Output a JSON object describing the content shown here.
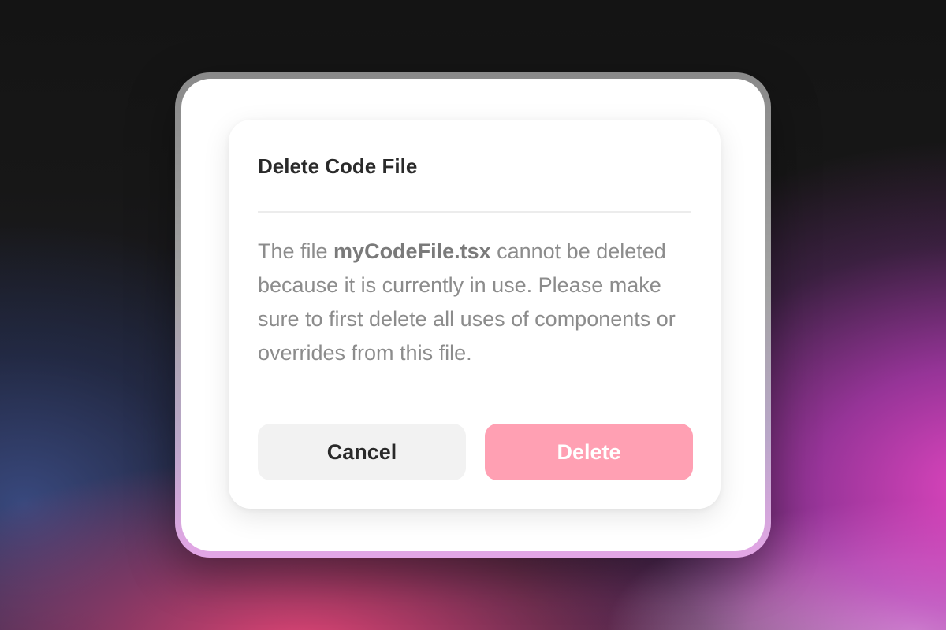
{
  "dialog": {
    "title": "Delete Code File",
    "message_prefix": "The file ",
    "file_name": "myCodeFile.tsx",
    "message_suffix": " cannot be deleted because it is currently in use. Please make sure to first delete all uses of components or overrides from this file.",
    "cancel_label": "Cancel",
    "delete_label": "Delete"
  },
  "colors": {
    "delete_button": "#ffa0b3",
    "cancel_button": "#f2f2f2",
    "title_text": "#2a2a2a",
    "body_text": "#8c8c8c"
  }
}
